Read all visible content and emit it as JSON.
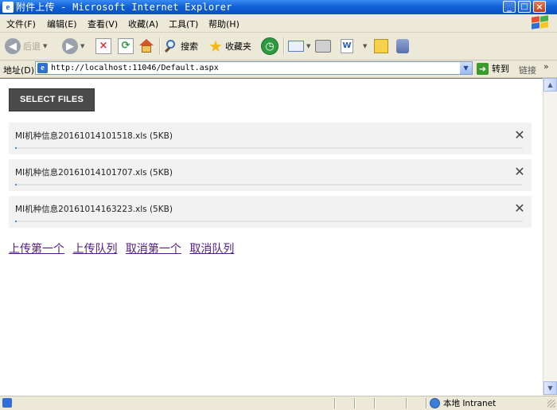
{
  "window": {
    "title": "附件上传 - Microsoft Internet Explorer",
    "icon": "ie-icon",
    "buttons": {
      "minimize": "_",
      "maximize": "□",
      "close": "×"
    }
  },
  "menu": {
    "items": [
      "文件(F)",
      "编辑(E)",
      "查看(V)",
      "收藏(A)",
      "工具(T)",
      "帮助(H)"
    ]
  },
  "toolbar": {
    "back_label": "后退",
    "search_label": "搜索",
    "favorites_label": "收藏夹"
  },
  "address": {
    "label": "地址(D)",
    "url": "http://localhost:11046/Default.aspx",
    "go_label": "转到",
    "links_label": "链接"
  },
  "page": {
    "select_button": "SELECT FILES",
    "files": [
      {
        "name": "MI机种信息20161014101518.xls (5KB)",
        "progress": 0
      },
      {
        "name": "MI机种信息20161014101707.xls (5KB)",
        "progress": 0
      },
      {
        "name": "MI机种信息20161014163223.xls (5KB)",
        "progress": 0
      }
    ],
    "actions": {
      "upload_first": "上传第一个",
      "upload_queue": "上传队列",
      "cancel_first": "取消第一个",
      "cancel_queue": "取消队列"
    }
  },
  "status": {
    "zone": "本地 Intranet"
  },
  "colors": {
    "link_visited": "#551a8b",
    "button_dark": "#4a4a4a",
    "file_row_bg": "#f2f2f2"
  }
}
